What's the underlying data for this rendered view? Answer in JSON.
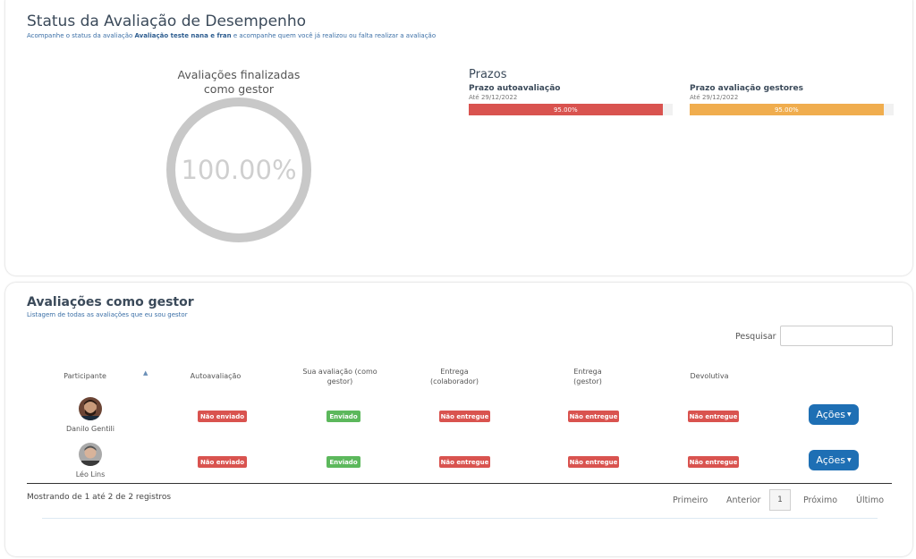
{
  "header": {
    "title": "Status da Avaliação de Desempenho",
    "subtitle_prefix": "Acompanhe o status da avaliação ",
    "subtitle_bold": "Avaliação teste nana e fran",
    "subtitle_suffix": " e acompanhe quem você já realizou ou falta realizar a avaliação"
  },
  "gauge": {
    "title": "Avaliações finalizadas como gestor",
    "value_label": "100.00%",
    "value": 1.0,
    "color": "#c8c8c8"
  },
  "prazos": {
    "title": "Prazos",
    "items": [
      {
        "name": "Prazo autoavaliação",
        "date": "Até 29/12/2022",
        "percent_label": "95.00%",
        "percent": 95,
        "color": "#d9534f"
      },
      {
        "name": "Prazo avaliação gestores",
        "date": "Até 29/12/2022",
        "percent_label": "95.00%",
        "percent": 95,
        "color": "#f0ad4e"
      }
    ]
  },
  "section": {
    "title": "Avaliações como gestor",
    "subtitle": "Listagem de todas as avaliações que eu sou gestor"
  },
  "search": {
    "label": "Pesquisar",
    "value": ""
  },
  "table": {
    "columns": [
      "Participante",
      "Autoavaliação",
      "Sua avaliação (como gestor)",
      "Entrega (colaborador)",
      "Entrega (gestor)",
      "Devolutiva"
    ],
    "rows": [
      {
        "name": "Danilo Gentili",
        "auto": "Não enviado",
        "sua": "Enviado",
        "entrega_colab": "Não entregue",
        "entrega_gestor": "Não entregue",
        "devolutiva": "Não entregue",
        "action": "Ações"
      },
      {
        "name": "Léo Lins",
        "auto": "Não enviado",
        "sua": "Enviado",
        "entrega_colab": "Não entregue",
        "entrega_gestor": "Não entregue",
        "devolutiva": "Não entregue",
        "action": "Ações"
      }
    ]
  },
  "footer": {
    "info": "Mostrando de 1 até 2 de 2 registros",
    "pagination": {
      "first": "Primeiro",
      "prev": "Anterior",
      "current": "1",
      "next": "Próximo",
      "last": "Último"
    }
  },
  "colors": {
    "red": "#d9534f",
    "green": "#5cb85c",
    "orange": "#f0ad4e",
    "blue": "#1e6fb4"
  }
}
